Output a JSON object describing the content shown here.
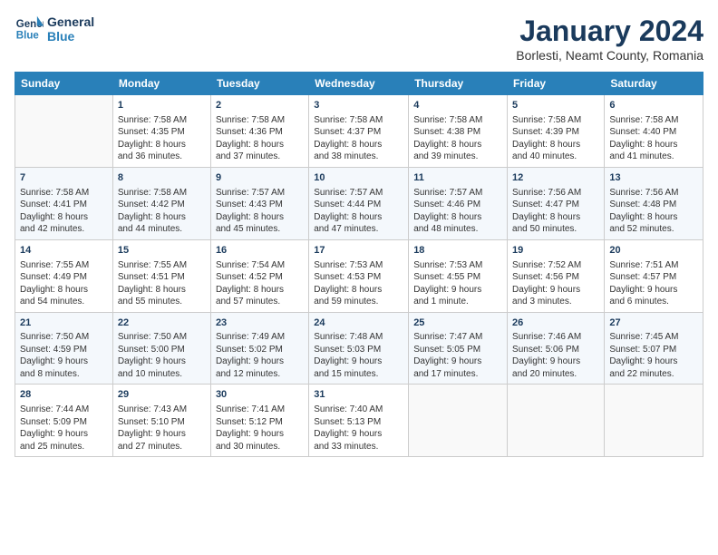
{
  "header": {
    "logo_line1": "General",
    "logo_line2": "Blue",
    "title": "January 2024",
    "subtitle": "Borlesti, Neamt County, Romania"
  },
  "days_of_week": [
    "Sunday",
    "Monday",
    "Tuesday",
    "Wednesday",
    "Thursday",
    "Friday",
    "Saturday"
  ],
  "weeks": [
    [
      {
        "day": "",
        "info": ""
      },
      {
        "day": "1",
        "info": "Sunrise: 7:58 AM\nSunset: 4:35 PM\nDaylight: 8 hours\nand 36 minutes."
      },
      {
        "day": "2",
        "info": "Sunrise: 7:58 AM\nSunset: 4:36 PM\nDaylight: 8 hours\nand 37 minutes."
      },
      {
        "day": "3",
        "info": "Sunrise: 7:58 AM\nSunset: 4:37 PM\nDaylight: 8 hours\nand 38 minutes."
      },
      {
        "day": "4",
        "info": "Sunrise: 7:58 AM\nSunset: 4:38 PM\nDaylight: 8 hours\nand 39 minutes."
      },
      {
        "day": "5",
        "info": "Sunrise: 7:58 AM\nSunset: 4:39 PM\nDaylight: 8 hours\nand 40 minutes."
      },
      {
        "day": "6",
        "info": "Sunrise: 7:58 AM\nSunset: 4:40 PM\nDaylight: 8 hours\nand 41 minutes."
      }
    ],
    [
      {
        "day": "7",
        "info": "Sunrise: 7:58 AM\nSunset: 4:41 PM\nDaylight: 8 hours\nand 42 minutes."
      },
      {
        "day": "8",
        "info": "Sunrise: 7:58 AM\nSunset: 4:42 PM\nDaylight: 8 hours\nand 44 minutes."
      },
      {
        "day": "9",
        "info": "Sunrise: 7:57 AM\nSunset: 4:43 PM\nDaylight: 8 hours\nand 45 minutes."
      },
      {
        "day": "10",
        "info": "Sunrise: 7:57 AM\nSunset: 4:44 PM\nDaylight: 8 hours\nand 47 minutes."
      },
      {
        "day": "11",
        "info": "Sunrise: 7:57 AM\nSunset: 4:46 PM\nDaylight: 8 hours\nand 48 minutes."
      },
      {
        "day": "12",
        "info": "Sunrise: 7:56 AM\nSunset: 4:47 PM\nDaylight: 8 hours\nand 50 minutes."
      },
      {
        "day": "13",
        "info": "Sunrise: 7:56 AM\nSunset: 4:48 PM\nDaylight: 8 hours\nand 52 minutes."
      }
    ],
    [
      {
        "day": "14",
        "info": "Sunrise: 7:55 AM\nSunset: 4:49 PM\nDaylight: 8 hours\nand 54 minutes."
      },
      {
        "day": "15",
        "info": "Sunrise: 7:55 AM\nSunset: 4:51 PM\nDaylight: 8 hours\nand 55 minutes."
      },
      {
        "day": "16",
        "info": "Sunrise: 7:54 AM\nSunset: 4:52 PM\nDaylight: 8 hours\nand 57 minutes."
      },
      {
        "day": "17",
        "info": "Sunrise: 7:53 AM\nSunset: 4:53 PM\nDaylight: 8 hours\nand 59 minutes."
      },
      {
        "day": "18",
        "info": "Sunrise: 7:53 AM\nSunset: 4:55 PM\nDaylight: 9 hours\nand 1 minute."
      },
      {
        "day": "19",
        "info": "Sunrise: 7:52 AM\nSunset: 4:56 PM\nDaylight: 9 hours\nand 3 minutes."
      },
      {
        "day": "20",
        "info": "Sunrise: 7:51 AM\nSunset: 4:57 PM\nDaylight: 9 hours\nand 6 minutes."
      }
    ],
    [
      {
        "day": "21",
        "info": "Sunrise: 7:50 AM\nSunset: 4:59 PM\nDaylight: 9 hours\nand 8 minutes."
      },
      {
        "day": "22",
        "info": "Sunrise: 7:50 AM\nSunset: 5:00 PM\nDaylight: 9 hours\nand 10 minutes."
      },
      {
        "day": "23",
        "info": "Sunrise: 7:49 AM\nSunset: 5:02 PM\nDaylight: 9 hours\nand 12 minutes."
      },
      {
        "day": "24",
        "info": "Sunrise: 7:48 AM\nSunset: 5:03 PM\nDaylight: 9 hours\nand 15 minutes."
      },
      {
        "day": "25",
        "info": "Sunrise: 7:47 AM\nSunset: 5:05 PM\nDaylight: 9 hours\nand 17 minutes."
      },
      {
        "day": "26",
        "info": "Sunrise: 7:46 AM\nSunset: 5:06 PM\nDaylight: 9 hours\nand 20 minutes."
      },
      {
        "day": "27",
        "info": "Sunrise: 7:45 AM\nSunset: 5:07 PM\nDaylight: 9 hours\nand 22 minutes."
      }
    ],
    [
      {
        "day": "28",
        "info": "Sunrise: 7:44 AM\nSunset: 5:09 PM\nDaylight: 9 hours\nand 25 minutes."
      },
      {
        "day": "29",
        "info": "Sunrise: 7:43 AM\nSunset: 5:10 PM\nDaylight: 9 hours\nand 27 minutes."
      },
      {
        "day": "30",
        "info": "Sunrise: 7:41 AM\nSunset: 5:12 PM\nDaylight: 9 hours\nand 30 minutes."
      },
      {
        "day": "31",
        "info": "Sunrise: 7:40 AM\nSunset: 5:13 PM\nDaylight: 9 hours\nand 33 minutes."
      },
      {
        "day": "",
        "info": ""
      },
      {
        "day": "",
        "info": ""
      },
      {
        "day": "",
        "info": ""
      }
    ]
  ]
}
